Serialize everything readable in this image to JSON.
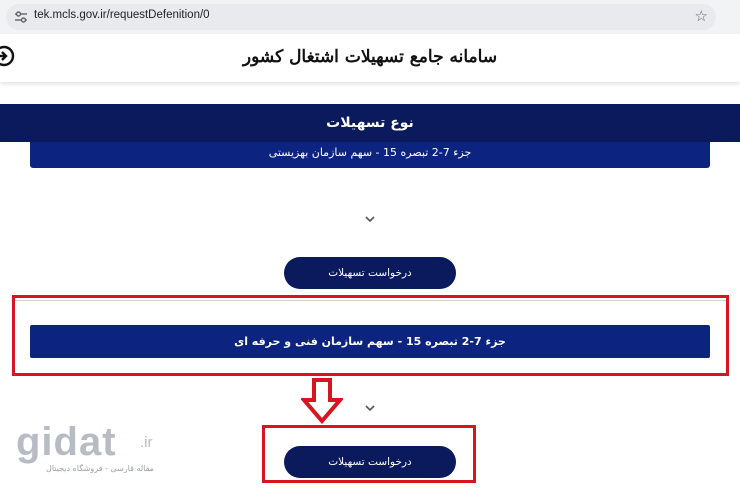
{
  "browser": {
    "url": "tek.mcls.gov.ir/requestDefenition/0"
  },
  "header": {
    "title": "سامانه جامع تسهیلات اشتغال کشور"
  },
  "section": {
    "title": "نوع تسهیلات"
  },
  "items": [
    {
      "label": "جزء 7-2 تبصره 15 - سهم سازمان بهزیستی",
      "button_label": "درخواست تسهیلات"
    },
    {
      "label": "جزء 7-2 تبصره 15 - سهم سازمان فنی و حرفه ای",
      "button_label": "درخواست تسهیلات"
    }
  ],
  "watermark": {
    "logo": "gidat",
    "tld": ".ir",
    "tagline": "مقاله فارسی - فروشگاه دیجیتال"
  },
  "colors": {
    "navy": "#0b1a5c",
    "item_blue": "#0d2380",
    "highlight_red": "#d7141f"
  },
  "icons": {
    "address_bar_left": "tune-icon",
    "address_bar_right": "star-icon",
    "header_left": "exit-icon",
    "expand": "chevron-down-icon",
    "annotation": "arrow-down-icon"
  }
}
